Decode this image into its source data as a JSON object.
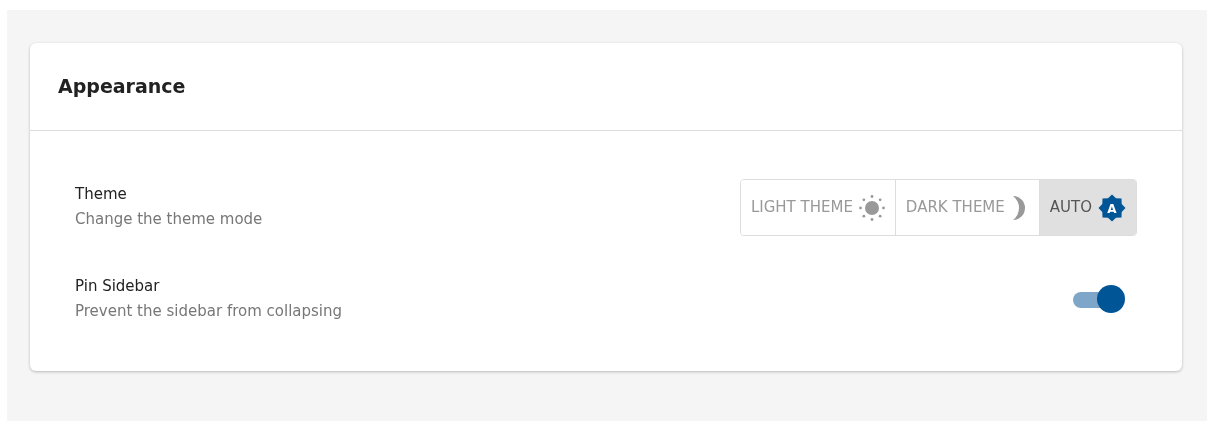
{
  "card": {
    "title": "Appearance"
  },
  "settings": [
    {
      "kind": "segmented",
      "label": "Theme",
      "description": "Change the theme mode",
      "options": [
        {
          "label": "LIGHT THEME",
          "kind": "sun",
          "selected": false
        },
        {
          "label": "DARK THEME",
          "kind": "moon",
          "selected": false
        },
        {
          "label": "AUTO",
          "kind": "auto",
          "icon_letter": "A",
          "selected": true
        }
      ]
    },
    {
      "kind": "switch",
      "label": "Pin Sidebar",
      "description": "Prevent the sidebar from collapsing",
      "on": true
    }
  ]
}
